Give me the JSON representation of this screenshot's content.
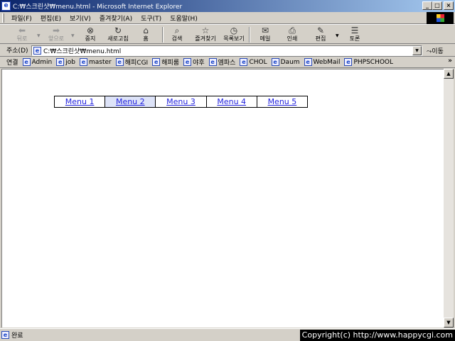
{
  "window": {
    "title": "C:₩스크린샷₩menu.html - Microsoft Internet Explorer",
    "app_icon": "ie-icon",
    "controls": {
      "minimize": "_",
      "maximize": "□",
      "close": "×"
    }
  },
  "menubar": {
    "items": [
      "파일(F)",
      "편집(E)",
      "보기(V)",
      "즐겨찾기(A)",
      "도구(T)",
      "도움말(H)"
    ]
  },
  "toolbar": {
    "back": "뒤로",
    "forward": "앞으로",
    "stop": "중지",
    "refresh": "새로고침",
    "home": "홈",
    "search": "검색",
    "favorites": "즐겨찾기",
    "history": "목록보기",
    "mail": "메일",
    "print": "인쇄",
    "edit": "편집",
    "discuss": "토론"
  },
  "address": {
    "label": "주소(D)",
    "value": "C:₩스크린샷₩menu.html",
    "go": "⤳이동"
  },
  "links": {
    "label": "연결",
    "items": [
      "Admin",
      "job",
      "master",
      "해피CGI",
      "해피룸",
      "야후",
      "엠파스",
      "CHOL",
      "Daum",
      "WebMail",
      "PHPSCHOOL"
    ],
    "more": "»"
  },
  "page": {
    "menu": [
      {
        "label": "Menu 1",
        "active": false
      },
      {
        "label": "Menu 2",
        "active": true
      },
      {
        "label": "Menu 3",
        "active": false
      },
      {
        "label": "Menu 4",
        "active": false
      },
      {
        "label": "Menu 5",
        "active": false
      }
    ]
  },
  "status": {
    "text": "완료",
    "copyright": "Copyright(c) http://www.happycgi.com"
  }
}
